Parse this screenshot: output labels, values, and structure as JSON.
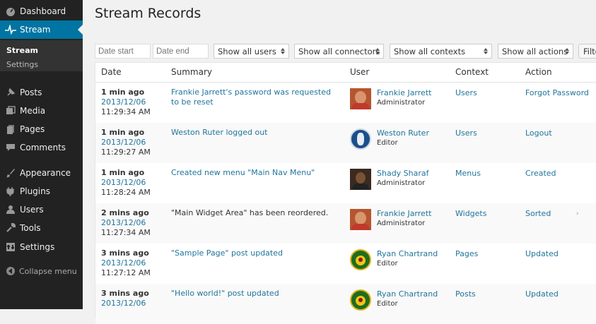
{
  "sidebar": {
    "items": [
      {
        "label": "Dashboard",
        "icon": "dashboard-icon"
      },
      {
        "label": "Stream",
        "icon": "stream-pulse-icon",
        "active": true
      },
      {
        "label": "Posts",
        "icon": "pin-icon"
      },
      {
        "label": "Media",
        "icon": "media-icon"
      },
      {
        "label": "Pages",
        "icon": "pages-icon"
      },
      {
        "label": "Comments",
        "icon": "comment-icon"
      },
      {
        "label": "Appearance",
        "icon": "brush-icon"
      },
      {
        "label": "Plugins",
        "icon": "plugin-icon"
      },
      {
        "label": "Users",
        "icon": "user-icon"
      },
      {
        "label": "Tools",
        "icon": "wrench-icon"
      },
      {
        "label": "Settings",
        "icon": "settings-icon"
      }
    ],
    "submenu": [
      {
        "label": "Stream",
        "current": true
      },
      {
        "label": "Settings"
      }
    ],
    "collapse_label": "Collapse menu"
  },
  "page": {
    "title": "Stream Records"
  },
  "filters": {
    "date_start_placeholder": "Date start",
    "date_end_placeholder": "Date end",
    "users": "Show all users",
    "connectors": "Show all connectors",
    "contexts": "Show all contexts",
    "actions": "Show all actions",
    "filter_button": "Filter"
  },
  "table": {
    "headers": {
      "date": "Date",
      "summary": "Summary",
      "user": "User",
      "context": "Context",
      "action": "Action"
    },
    "rows": [
      {
        "ago": "1 min ago",
        "date": "2013/12/06",
        "time": "11:29:34 AM",
        "summary": "Frankie Jarrett's password was requested to be reset",
        "summary_link": true,
        "user": "Frankie Jarrett",
        "role": "Administrator",
        "avatar": "frankie",
        "context": "Users",
        "action": "Forgot Password"
      },
      {
        "ago": "1 min ago",
        "date": "2013/12/06",
        "time": "11:29:27 AM",
        "summary": "Weston Ruter logged out",
        "summary_link": true,
        "user": "Weston Ruter",
        "role": "Editor",
        "avatar": "weston",
        "context": "Users",
        "action": "Logout"
      },
      {
        "ago": "1 min ago",
        "date": "2013/12/06",
        "time": "11:28:24 AM",
        "summary": "Created new menu \"Main Nav Menu\"",
        "summary_link": true,
        "user": "Shady Sharaf",
        "role": "Administrator",
        "avatar": "shady",
        "context": "Menus",
        "action": "Created"
      },
      {
        "ago": "2 mins ago",
        "date": "2013/12/06",
        "time": "11:27:34 AM",
        "summary": "\"Main Widget Area\" has been reordered.",
        "summary_link": false,
        "user": "Frankie Jarrett",
        "role": "Administrator",
        "avatar": "frankie",
        "context": "Widgets",
        "action": "Sorted"
      },
      {
        "ago": "3 mins ago",
        "date": "2013/12/06",
        "time": "11:27:12 AM",
        "summary": "\"Sample Page\" post updated",
        "summary_link": true,
        "user": "Ryan Chartrand",
        "role": "Editor",
        "avatar": "ryan",
        "context": "Pages",
        "action": "Updated"
      },
      {
        "ago": "3 mins ago",
        "date": "2013/12/06",
        "time": "",
        "summary": "\"Hello world!\" post updated",
        "summary_link": true,
        "user": "Ryan Chartrand",
        "role": "Editor",
        "avatar": "ryan",
        "context": "Posts",
        "action": "Updated"
      }
    ]
  },
  "colors": {
    "sidebar_bg": "#222222",
    "active_bg": "#0074a2",
    "link": "#21759b"
  }
}
